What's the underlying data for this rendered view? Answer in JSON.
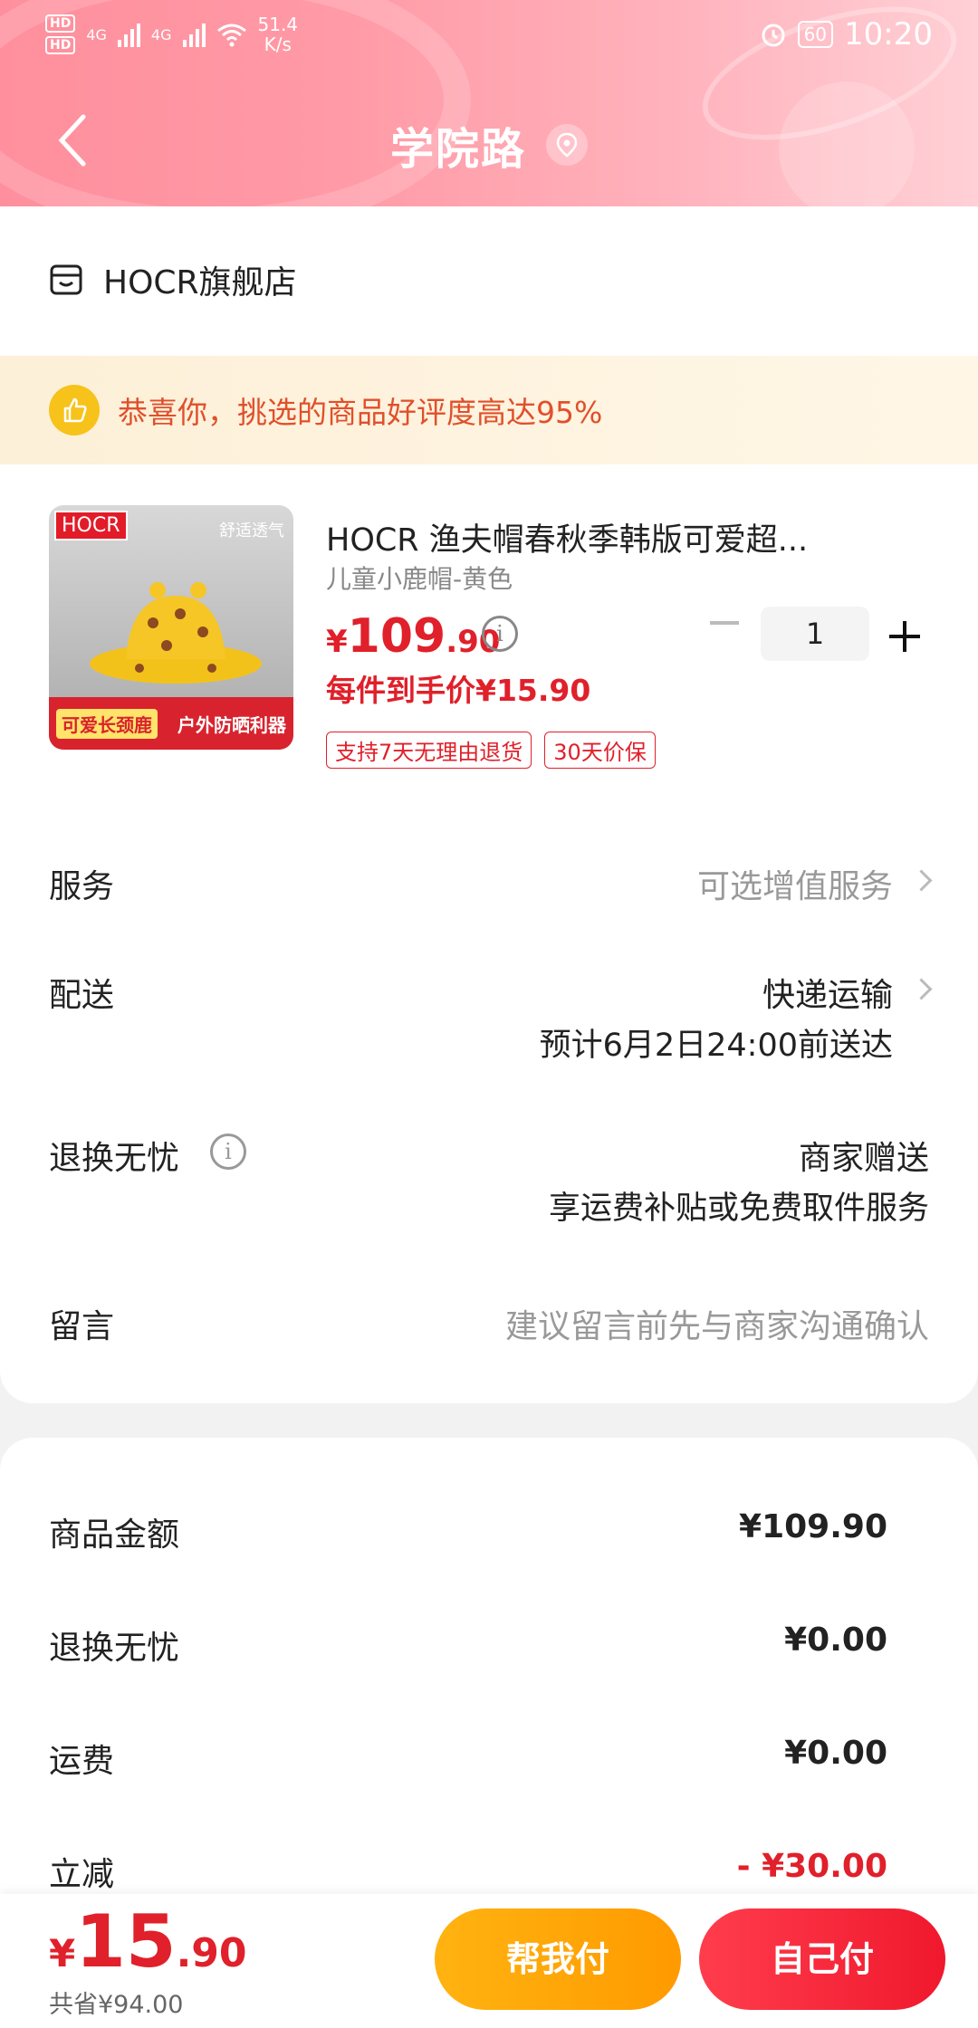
{
  "status_bar": {
    "hd1": "HD",
    "hd2": "HD",
    "net1": "4G",
    "net2": "4G",
    "speed": "51.4",
    "speed_unit": "K/s",
    "battery": "60",
    "time": "10:20"
  },
  "header": {
    "title": "学院路"
  },
  "store": {
    "name": "HOCR旗舰店"
  },
  "promo": {
    "text": "恭喜你，挑选的商品好评度高达95%"
  },
  "product": {
    "image_brand": "HOCR",
    "image_tag": "舒适透气",
    "image_bottom_left": "可爱长颈鹿",
    "image_bottom_right": "户外防晒利器",
    "name": "HOCR   渔夫帽春秋季韩版可爱超...",
    "spec": "儿童小鹿帽-黄色",
    "price_yen": "¥",
    "price_int": "109",
    "price_dec": ".90",
    "quantity": "1",
    "unit_price": "每件到手价¥15.90",
    "tags": [
      "支持7天无理由退货",
      "30天价保"
    ]
  },
  "rows": {
    "service_label": "服务",
    "service_value": "可选增值服务",
    "delivery_label": "配送",
    "delivery_value": "快递运输",
    "delivery_eta": "预计6月2日24:00前送达",
    "returns_label": "退换无忧",
    "returns_value": "商家赠送",
    "returns_sub": "享运费补贴或免费取件服务",
    "message_label": "留言",
    "message_placeholder": "建议留言前先与商家沟通确认"
  },
  "fees": [
    {
      "label": "商品金额",
      "value": "¥109.90"
    },
    {
      "label": "退换无忧",
      "value": "¥0.00"
    },
    {
      "label": "运费",
      "value": "¥0.00"
    },
    {
      "label": "立减",
      "value": "- ¥30.00"
    }
  ],
  "bottom": {
    "total_yen": "¥",
    "total_int": "15",
    "total_dec": ".90",
    "saved": "共省¥94.00",
    "help_pay": "帮我付",
    "self_pay": "自己付"
  },
  "colors": {
    "accent_red": "#e0202a",
    "orange_button": "#ffa500",
    "header_pink": "#ff9aa6"
  }
}
